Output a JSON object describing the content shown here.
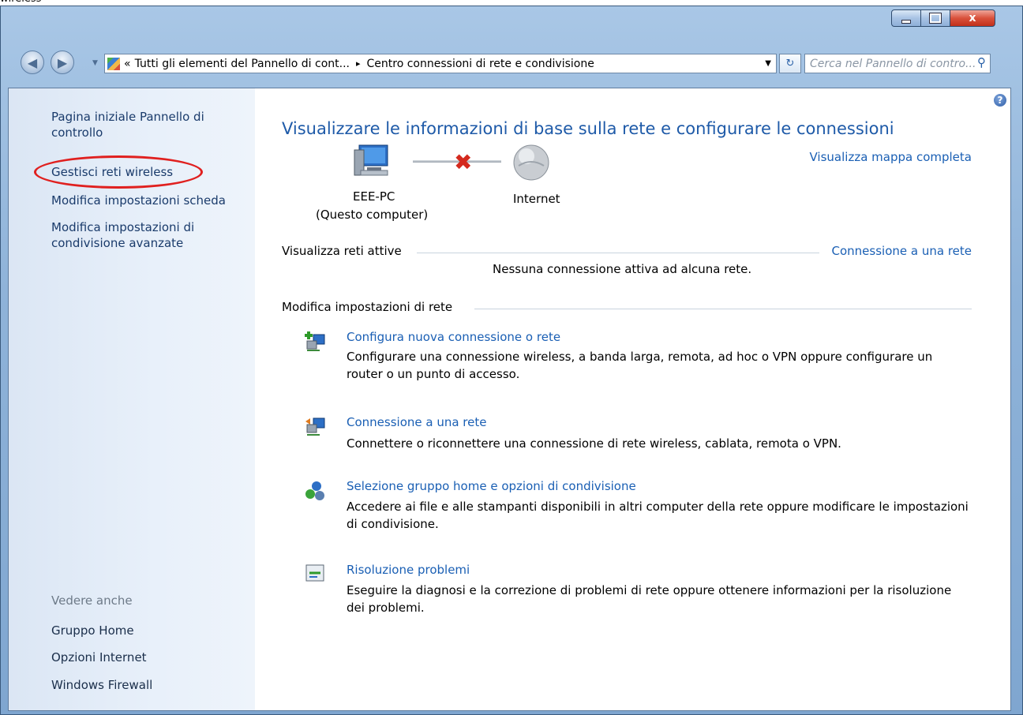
{
  "window": {
    "caption_fragment": "wireless",
    "close_glyph": "x",
    "min_icon": "minimize-icon",
    "max_icon": "maximize-icon"
  },
  "navigation": {
    "back_icon": "back-arrow-icon",
    "forward_icon": "forward-arrow-icon",
    "address": {
      "overflow": "«",
      "crumb1": "Tutti gli elementi del Pannello di cont...",
      "separator": "▸",
      "crumb2": "Centro connessioni di rete e condivisione"
    },
    "search_placeholder": "Cerca nel Pannello di contro..."
  },
  "sidebar": {
    "links": [
      {
        "label": "Pagina iniziale Pannello di controllo"
      },
      {
        "label": "Gestisci reti wireless"
      },
      {
        "label": "Modifica impostazioni scheda"
      },
      {
        "label": "Modifica impostazioni di condivisione avanzate"
      }
    ],
    "see_also_header": "Vedere anche",
    "see_also": [
      {
        "label": "Gruppo Home"
      },
      {
        "label": "Opzioni Internet"
      },
      {
        "label": "Windows Firewall"
      }
    ]
  },
  "main": {
    "title": "Visualizzare le informazioni di base sulla rete e configurare le connessioni",
    "full_map_link": "Visualizza mappa completa",
    "map": {
      "computer_name": "EEE-PC",
      "computer_sub": "(Questo computer)",
      "internet_label": "Internet"
    },
    "active_networks": {
      "header": "Visualizza reti attive",
      "link": "Connessione a una rete",
      "status": "Nessuna connessione attiva ad alcuna rete."
    },
    "settings": {
      "header": "Modifica impostazioni di rete",
      "options": [
        {
          "title": "Configura nuova connessione o rete",
          "desc": "Configurare una connessione wireless, a banda larga, remota, ad hoc o VPN oppure configurare un router o un punto di accesso.",
          "icon": "new-connection-icon"
        },
        {
          "title": "Connessione a una rete",
          "desc": "Connettere o riconnettere una connessione di rete wireless, cablata, remota o VPN.",
          "icon": "connect-network-icon"
        },
        {
          "title": "Selezione gruppo home e opzioni di condivisione",
          "desc": "Accedere ai file e alle stampanti disponibili in altri computer della rete oppure modificare le impostazioni di condivisione.",
          "icon": "homegroup-icon"
        },
        {
          "title": "Risoluzione problemi",
          "desc": "Eseguire la diagnosi e la correzione di problemi di rete oppure ottenere informazioni per la risoluzione dei problemi.",
          "icon": "troubleshoot-icon"
        }
      ]
    }
  },
  "annotation": {
    "color": "#e0201f"
  }
}
